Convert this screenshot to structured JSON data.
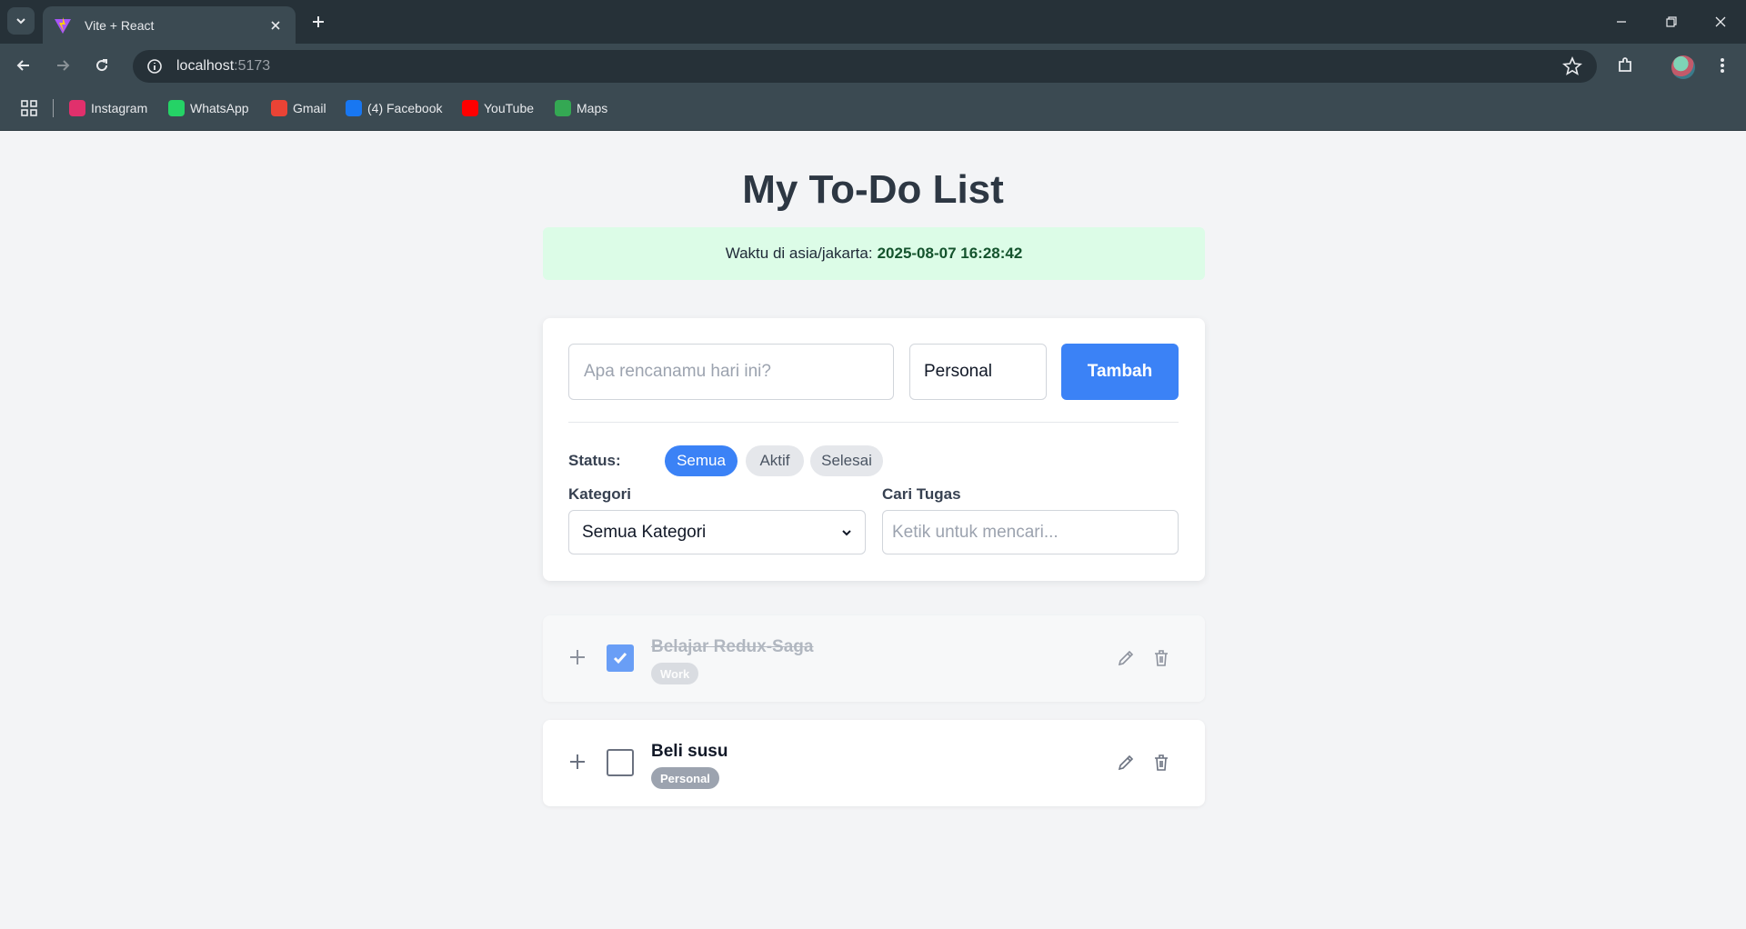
{
  "browser": {
    "tab_title": "Vite + React",
    "url_host": "localhost",
    "url_port": ":5173",
    "bookmarks": [
      {
        "label": "Instagram",
        "icon": "instagram-icon",
        "color": "#e1306c"
      },
      {
        "label": "WhatsApp",
        "icon": "whatsapp-icon",
        "color": "#25d366"
      },
      {
        "label": "Gmail",
        "icon": "gmail-icon",
        "color": "#ea4335"
      },
      {
        "label": "(4) Facebook",
        "icon": "facebook-icon",
        "color": "#1877f2"
      },
      {
        "label": "YouTube",
        "icon": "youtube-icon",
        "color": "#ff0000"
      },
      {
        "label": "Maps",
        "icon": "maps-icon",
        "color": "#34a853"
      }
    ]
  },
  "app": {
    "title": "My To-Do List",
    "clock_label": "Waktu di asia/jakarta:",
    "clock_value": "2025-08-07 16:28:42",
    "task_placeholder": "Apa rencanamu hari ini?",
    "category_value": "Personal",
    "add_label": "Tambah",
    "status_label": "Status:",
    "status_filters": [
      "Semua",
      "Aktif",
      "Selesai"
    ],
    "active_filter": "Semua",
    "category_filter_label": "Kategori",
    "category_filter_value": "Semua Kategori",
    "search_label": "Cari Tugas",
    "search_placeholder": "Ketik untuk mencari..."
  },
  "todos": [
    {
      "text": "Belajar Redux-Saga",
      "tag": "Work",
      "done": true
    },
    {
      "text": "Beli susu",
      "tag": "Personal",
      "done": false
    }
  ],
  "colors": {
    "accent": "#3b82f6",
    "clock_bg": "#dcfce7",
    "page_bg": "#f3f4f6"
  }
}
